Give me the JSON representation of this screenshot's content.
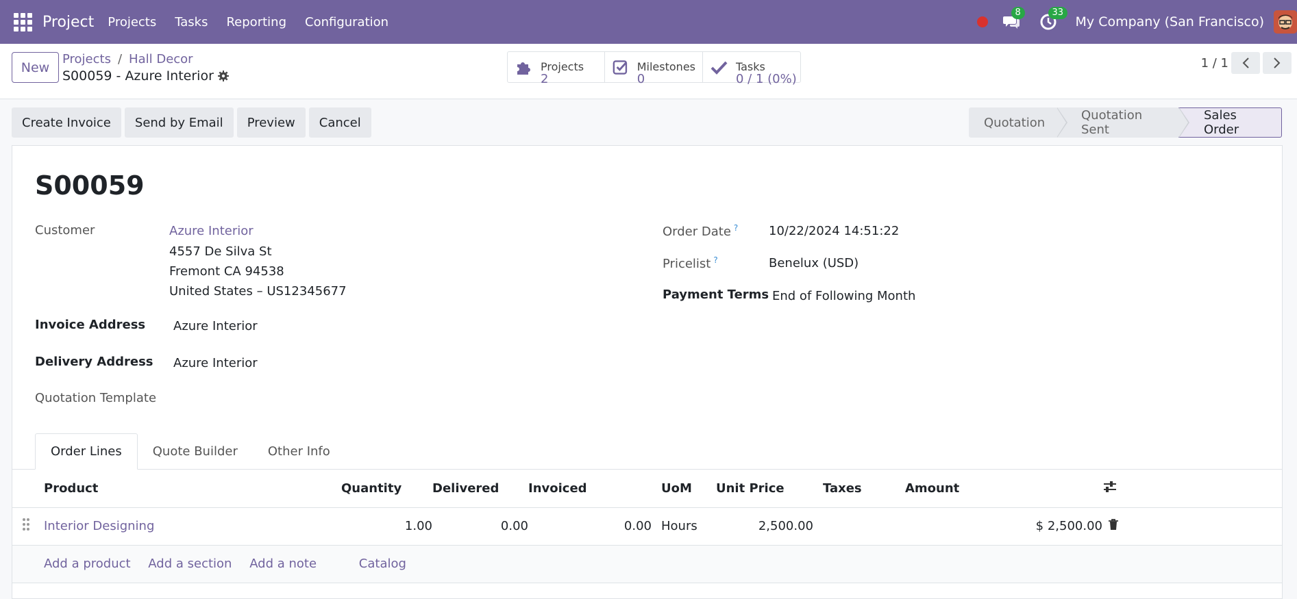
{
  "navbar": {
    "brand": "Project",
    "menu": [
      "Projects",
      "Tasks",
      "Reporting",
      "Configuration"
    ],
    "messages_count": "8",
    "activities_count": "33",
    "company": "My Company (San Francisco)"
  },
  "control": {
    "new_label": "New",
    "breadcrumb": [
      "Projects",
      "Hall Decor"
    ],
    "breadcrumb_sep": "/",
    "record_name": "S00059 - Azure Interior",
    "smart": {
      "projects": {
        "label": "Projects",
        "value": "2"
      },
      "milestones": {
        "label": "Milestones",
        "value": "0"
      },
      "tasks": {
        "label": "Tasks",
        "value": "0 / 1 (0%)"
      }
    },
    "pager": "1 / 1"
  },
  "actions": [
    "Create Invoice",
    "Send by Email",
    "Preview",
    "Cancel"
  ],
  "stages": [
    "Quotation",
    "Quotation Sent",
    "Sales Order"
  ],
  "form": {
    "title": "S00059",
    "customer_label": "Customer",
    "customer_name": "Azure Interior",
    "customer_address": [
      "4557 De Silva St",
      "Fremont CA 94538",
      "United States – US12345677"
    ],
    "invoice_label": "Invoice Address",
    "invoice_value": "Azure Interior",
    "delivery_label": "Delivery Address",
    "delivery_value": "Azure Interior",
    "template_label": "Quotation Template",
    "order_date_label": "Order Date",
    "order_date": "10/22/2024 14:51:22",
    "pricelist_label": "Pricelist",
    "pricelist": "Benelux (USD)",
    "payment_terms_label": "Payment Terms",
    "payment_terms": "End of Following Month",
    "help_mark": "?"
  },
  "tabs": [
    "Order Lines",
    "Quote Builder",
    "Other Info"
  ],
  "table": {
    "headers": [
      "Product",
      "Quantity",
      "Delivered",
      "Invoiced",
      "UoM",
      "Unit Price",
      "Taxes",
      "Amount"
    ],
    "rows": [
      {
        "product": "Interior Designing",
        "quantity": "1.00",
        "delivered": "0.00",
        "invoiced": "0.00",
        "uom": "Hours",
        "unit_price": "2,500.00",
        "taxes": "",
        "amount": "$ 2,500.00"
      }
    ],
    "add_links": [
      "Add a product",
      "Add a section",
      "Add a note",
      "Catalog"
    ]
  },
  "colors": {
    "brand": "#71639e",
    "badge": "#28a745",
    "record": "#d9322d"
  }
}
